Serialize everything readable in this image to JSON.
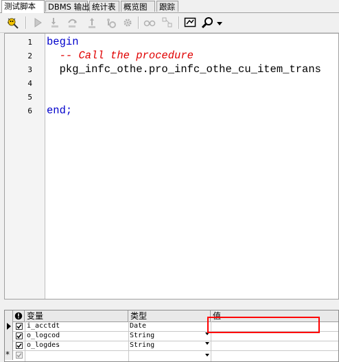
{
  "tabs": [
    "测试脚本",
    "DBMS 输出",
    "统计表",
    "概览图",
    "跟踪"
  ],
  "toolbar": {
    "icons": [
      "run-debug-icon",
      "execute-icon",
      "step-into-icon",
      "step-over-icon",
      "step-out-icon",
      "breakpoint-gear-icon",
      "watch-icon",
      "variables-icon",
      "screen-icon",
      "search-icon",
      "dropdown-arrow-icon"
    ]
  },
  "editor": {
    "line_numbers": [
      "1",
      "2",
      "3",
      "4",
      "5",
      "6"
    ],
    "lines": {
      "l1": "begin",
      "l2": "  -- Call the procedure",
      "l3": "  pkg_infc_othe.pro_infc_othe_cu_item_trans",
      "l6": "end;"
    }
  },
  "grid": {
    "headers": {
      "var": "变量",
      "type": "类型",
      "value": "值"
    },
    "rows": [
      {
        "name": "i_acctdt",
        "type": "Date",
        "value": ""
      },
      {
        "name": "o_logcod",
        "type": "String",
        "value": ""
      },
      {
        "name": "o_logdes",
        "type": "String",
        "value": ""
      }
    ],
    "new_row_marker": "*"
  },
  "colors": {
    "keyword": "#0000cc",
    "comment": "#e00000",
    "highlight": "#ff0000"
  }
}
